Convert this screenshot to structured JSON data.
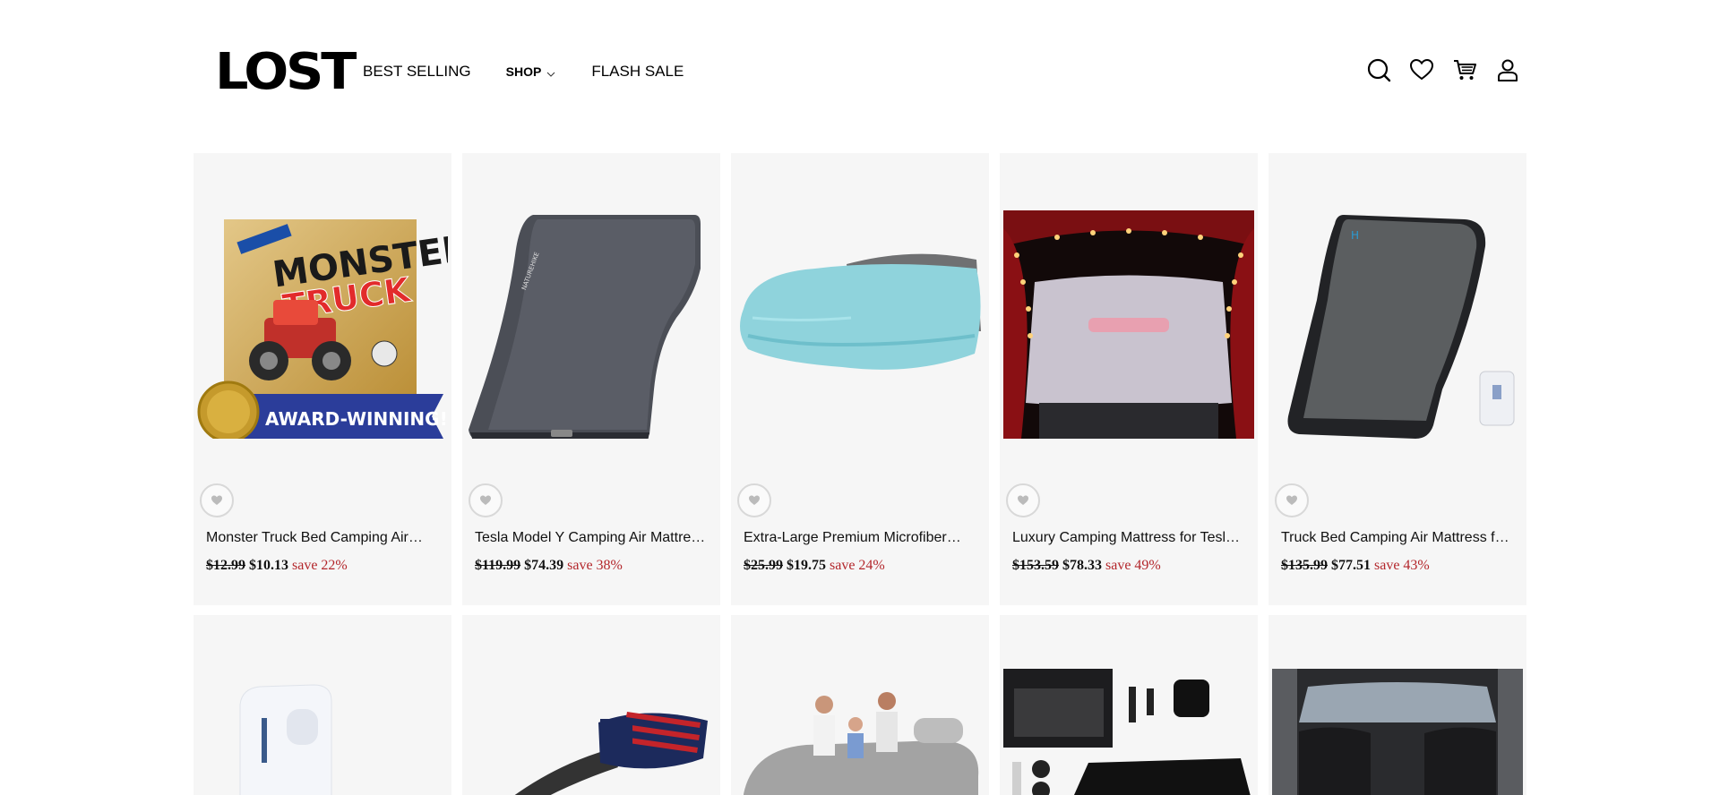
{
  "header": {
    "logo": "LOST",
    "nav": {
      "best_selling": "BEST SELLING",
      "shop": "SHOP",
      "flash_sale": "FLASH SALE"
    },
    "icons": [
      "search-icon",
      "heart-icon",
      "cart-icon",
      "account-icon"
    ]
  },
  "products": [
    {
      "title": "Monster Truck Bed Camping Air…",
      "old_price": "$12.99",
      "price": "$10.13",
      "save": "save 22%",
      "image": "monster-truck-craft-kit",
      "badge": "AWARD-WINNING!"
    },
    {
      "title": "Tesla Model Y Camping Air Mattress…",
      "old_price": "$119.99",
      "price": "$74.39",
      "save": "save 38%",
      "image": "grey-air-mattress"
    },
    {
      "title": "Extra-Large Premium Microfiber…",
      "old_price": "$25.99",
      "price": "$19.75",
      "save": "save 24%",
      "image": "blue-microfiber-towel"
    },
    {
      "title": "Luxury Camping Mattress for Tesla…",
      "old_price": "$153.59",
      "price": "$78.33",
      "save": "save 49%",
      "image": "mattress-in-tesla-trunk"
    },
    {
      "title": "Truck Bed Camping Air Mattress for…",
      "old_price": "$135.99",
      "price": "$77.51",
      "save": "save 43%",
      "image": "dark-air-mattress-with-pump"
    }
  ],
  "products_row2": [
    {
      "image": "white-air-pump"
    },
    {
      "image": "flag-hitch-step"
    },
    {
      "image": "family-on-inflatable-mattress"
    },
    {
      "image": "mattress-kit-accessories"
    },
    {
      "image": "car-trunk-interior"
    }
  ],
  "colors": {
    "sale_red": "#b3262b",
    "card_bg": "#f6f6f6"
  }
}
